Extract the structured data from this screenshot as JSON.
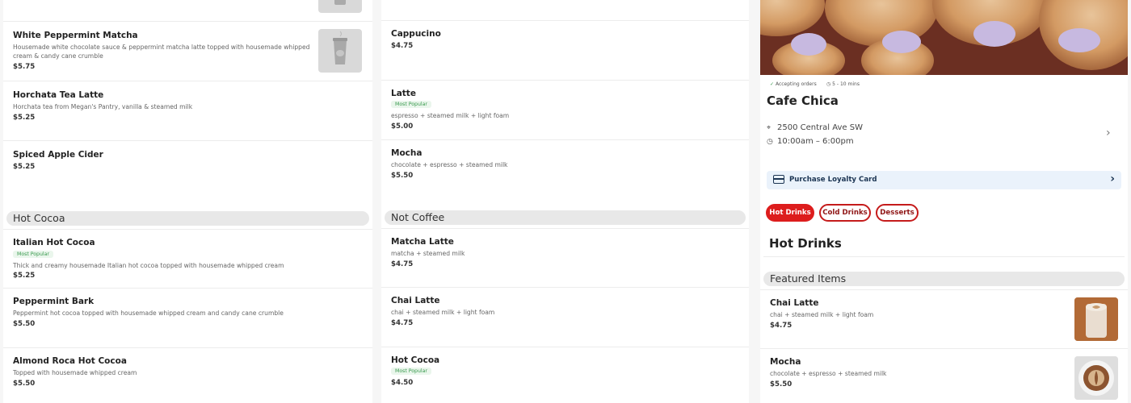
{
  "left_column": {
    "items_top": [
      {
        "name": "White Peppermint Matcha",
        "description": "Housemade white chocolate sauce & peppermint matcha latte topped with housemade whipped cream & candy cane crumble",
        "price": "$5.75"
      },
      {
        "name": "Horchata Tea Latte",
        "description": "Horchata tea from Megan's Pantry, vanilla & steamed milk",
        "price": "$5.25"
      },
      {
        "name": "Spiced Apple Cider",
        "price": "$5.25"
      }
    ],
    "section_title": "Hot Cocoa",
    "items_bottom": [
      {
        "name": "Italian Hot Cocoa",
        "badge": "Most Popular",
        "description": "Thick and creamy housemade Italian hot cocoa topped with housemade whipped cream",
        "price": "$5.25"
      },
      {
        "name": "Peppermint Bark",
        "description": "Peppermint hot cocoa topped with housemade whipped cream and candy cane crumble",
        "price": "$5.50"
      },
      {
        "name": "Almond Roca Hot Cocoa",
        "description": "Topped with housemade whipped cream",
        "price": "$5.50"
      }
    ]
  },
  "middle_column": {
    "items_top": [
      {
        "name": "Cappucino",
        "price": "$4.75"
      },
      {
        "name": "Latte",
        "badge": "Most Popular",
        "description": "espresso + steamed milk + light foam",
        "price": "$5.00"
      },
      {
        "name": "Mocha",
        "description": "chocolate + espresso + steamed milk",
        "price": "$5.50"
      }
    ],
    "section_title": "Not Coffee",
    "items_bottom": [
      {
        "name": "Matcha Latte",
        "description": "matcha + steamed milk",
        "price": "$4.75"
      },
      {
        "name": "Chai Latte",
        "description": "chai + steamed milk + light foam",
        "price": "$4.75"
      },
      {
        "name": "Hot Cocoa",
        "badge": "Most Popular",
        "price": "$4.50"
      }
    ]
  },
  "store": {
    "status_accepting": "Accepting orders",
    "status_time": "5 - 10 mins",
    "name": "Cafe Chica",
    "address": "2500 Central Ave SW",
    "hours": "10:00am – 6:00pm",
    "loyalty_label": "Purchase Loyalty Card",
    "tabs": [
      "Hot Drinks",
      "Cold Drinks",
      "Desserts"
    ],
    "active_tab": "Hot Drinks",
    "category_title": "Hot Drinks",
    "featured_title": "Featured Items",
    "featured_items": [
      {
        "name": "Chai Latte",
        "description": "chai + steamed milk + light foam",
        "price": "$4.75"
      },
      {
        "name": "Mocha",
        "description": "chocolate + espresso + steamed milk",
        "price": "$5.50"
      }
    ]
  },
  "icons": {
    "check": "check-icon",
    "clock": "clock-icon",
    "location": "location-pin-icon",
    "card": "card-icon",
    "chevron": "chevron-right-icon",
    "cup": "cup-placeholder-icon"
  },
  "colors": {
    "accent_red": "#dd1d1d",
    "badge_green": "#3a9a4f",
    "loyalty_bg": "#eaf2fb",
    "loyalty_text": "#1c3553"
  }
}
